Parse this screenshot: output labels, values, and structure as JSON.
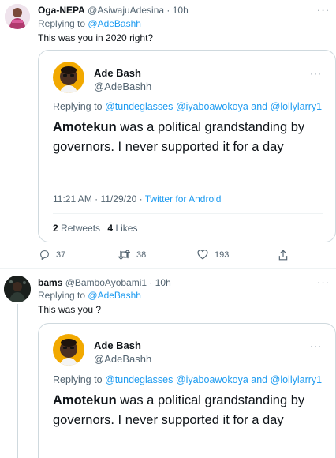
{
  "tweet1": {
    "name": "Oga-NEPA",
    "handle": "@AsiwajuAdesina",
    "time": "10h",
    "replying_label": "Replying to",
    "replying_handle": "@AdeBashh",
    "text": "This was you in 2020 right?",
    "more": "···"
  },
  "tweet2": {
    "name": "bams",
    "handle": "@BamboAyobami1",
    "time": "10h",
    "replying_label": "Replying to",
    "replying_handle": "@AdeBashh",
    "text": "This was you ?",
    "more": "···"
  },
  "quote": {
    "name": "Ade Bash",
    "handle": "@AdeBashh",
    "more": "···",
    "replying_label": "Replying to",
    "replying_handle1": "@tundeglasses",
    "replying_handle2": "@iyaboawokoya",
    "replying_and": "and",
    "replying_handle3": "@lollylarry1",
    "text_bold": "Amotekun",
    "text_rest": " was a political grandstanding by governors. I never supported it for a day",
    "time": "11:21 AM · 11/29/20 · ",
    "source": "Twitter for Android",
    "retweets_count": "2",
    "retweets_label": "Retweets",
    "likes_count": "4",
    "likes_label": "Likes"
  },
  "actions": {
    "replies": "37",
    "retweets": "38",
    "likes": "193"
  },
  "colors": {
    "accent": "#1d9bf0",
    "text": "#0f1419",
    "secondary": "#536471",
    "border": "#cfd9de"
  }
}
